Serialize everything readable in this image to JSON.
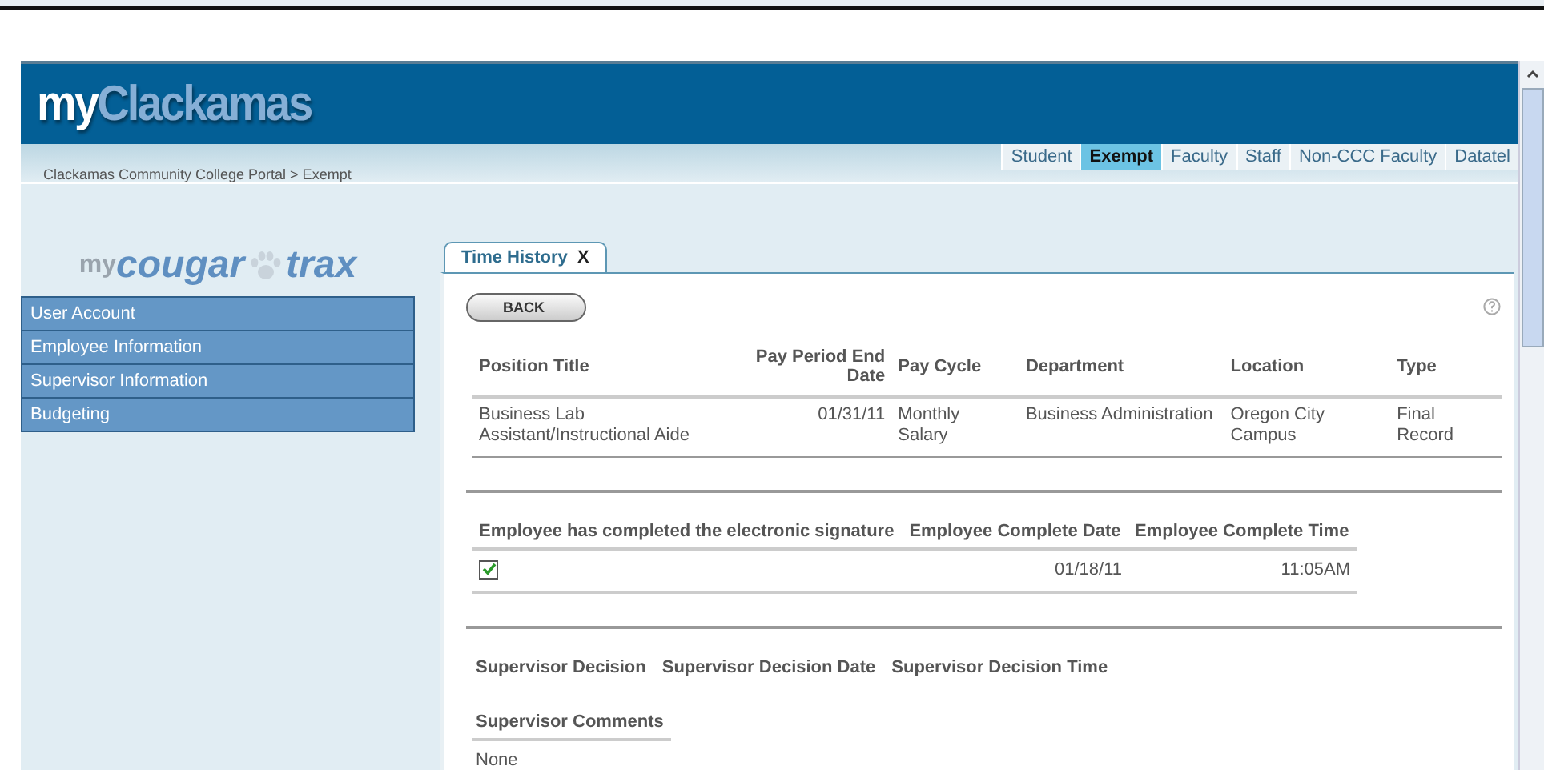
{
  "header": {
    "logo_prefix": "my",
    "logo_name": "Clackamas"
  },
  "breadcrumb": "Clackamas Community College Portal  > Exempt",
  "role_tabs": [
    {
      "label": "Student",
      "selected": false
    },
    {
      "label": "Exempt",
      "selected": true
    },
    {
      "label": "Faculty",
      "selected": false
    },
    {
      "label": "Staff",
      "selected": false
    },
    {
      "label": "Non-CCC Faculty",
      "selected": false
    },
    {
      "label": "Datatel",
      "selected": false
    }
  ],
  "sidebar": {
    "logo": {
      "prefix": "my",
      "word1": "cougar",
      "word2": "trax"
    },
    "items": [
      "User Account",
      "Employee Information",
      "Supervisor Information",
      "Budgeting"
    ]
  },
  "tabs": [
    {
      "label": "Time History",
      "close": "X",
      "selected": true
    }
  ],
  "back_button": "BACK",
  "position_table": {
    "columns": [
      {
        "label": "Position Title",
        "kind": "text"
      },
      {
        "label": "Pay Period End Date",
        "kind": "date"
      },
      {
        "label": "Pay Cycle",
        "kind": "text"
      },
      {
        "label": "Department",
        "kind": "text"
      },
      {
        "label": "Location",
        "kind": "text"
      },
      {
        "label": "Type",
        "kind": "text"
      }
    ],
    "rows": [
      [
        "Business Lab Assistant/Instructional Aide",
        "01/31/11",
        "Monthly Salary",
        "Business Administration",
        "Oregon City Campus",
        "Final Record"
      ]
    ]
  },
  "signature_table": {
    "columns": [
      "Employee has completed the electronic signature",
      "Employee Complete Date",
      "Employee Complete Time"
    ],
    "rows": [
      {
        "checked": true,
        "date": "01/18/11",
        "time": "11:05AM"
      }
    ]
  },
  "supervisor": {
    "columns": [
      "Supervisor Decision",
      "Supervisor Decision Date",
      "Supervisor Decision Time"
    ],
    "comments_heading": "Supervisor Comments",
    "comments": "None"
  }
}
